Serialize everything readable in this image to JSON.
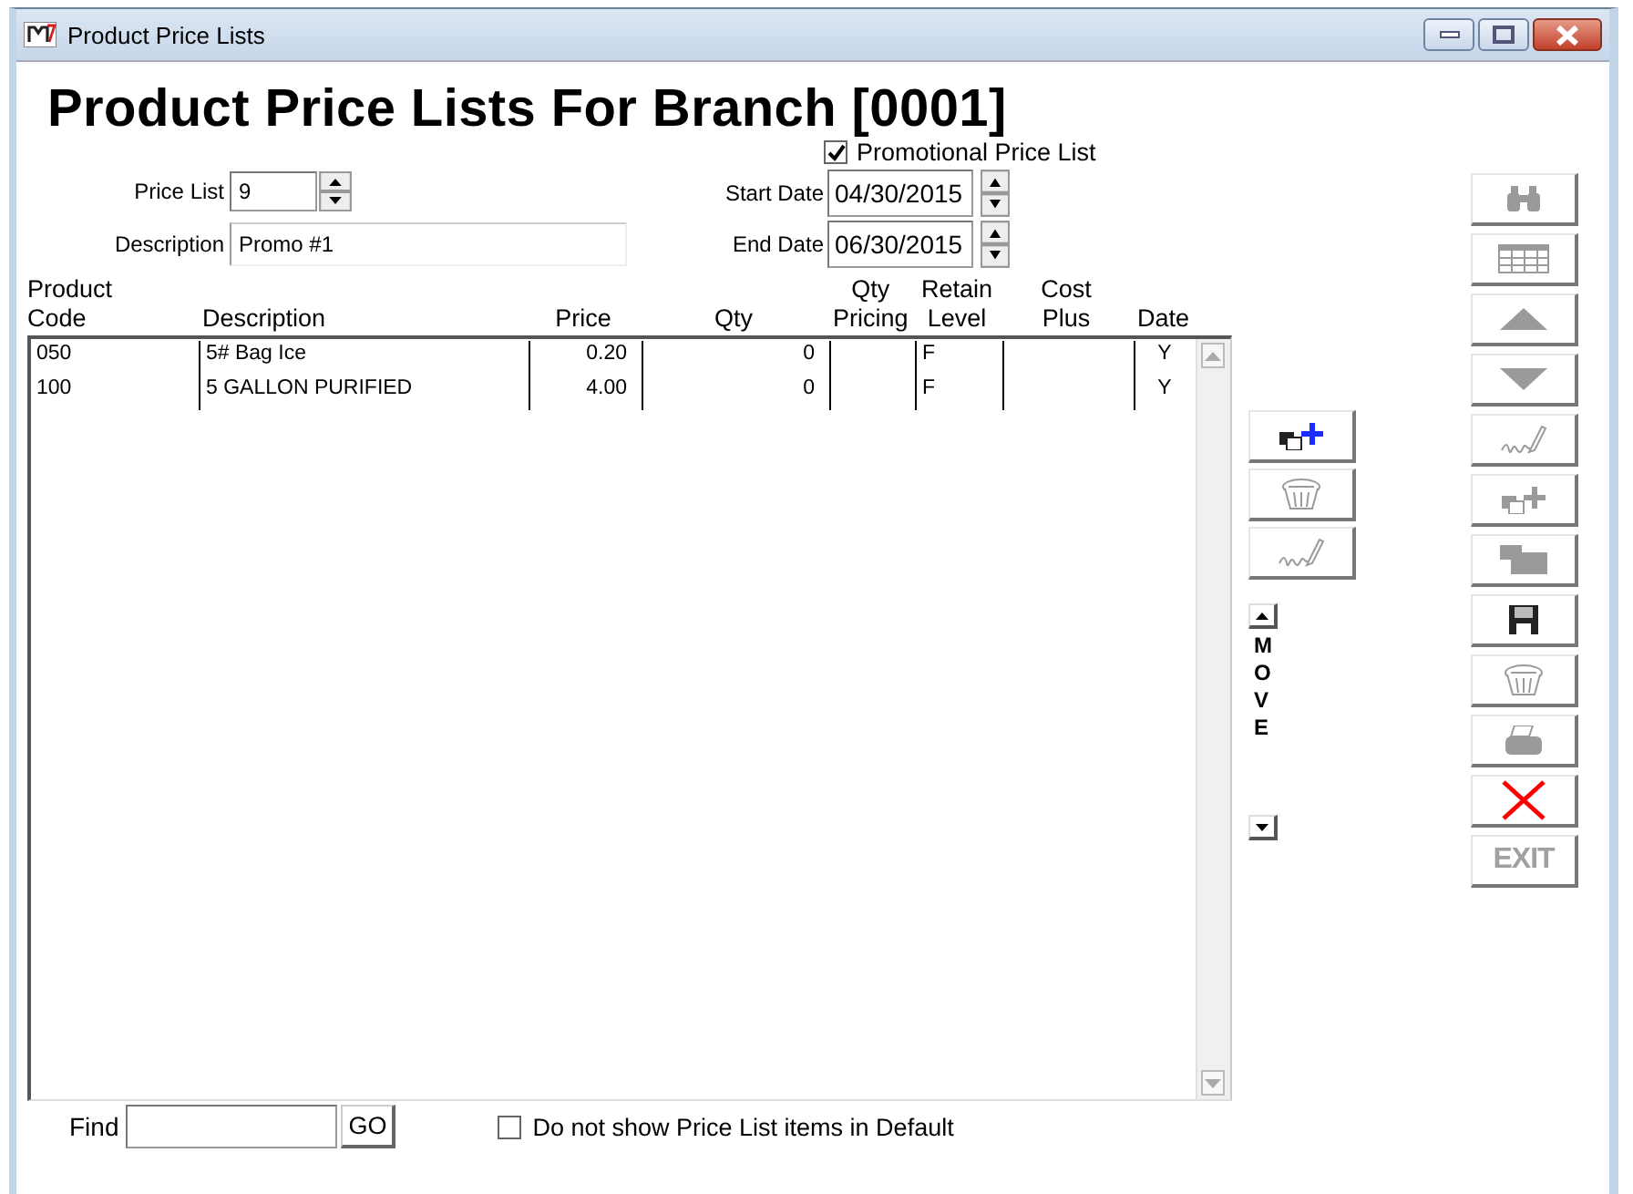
{
  "window": {
    "title": "Product Price Lists"
  },
  "heading": "Product Price Lists For Branch [0001]",
  "form": {
    "price_list": {
      "label": "Price List",
      "value": "9"
    },
    "description": {
      "label": "Description",
      "value": "Promo #1"
    },
    "promotional": {
      "label": "Promotional Price List",
      "checked": true
    },
    "start_date": {
      "label": "Start Date",
      "value": "04/30/2015"
    },
    "end_date": {
      "label": "End Date",
      "value": "06/30/2015"
    }
  },
  "table": {
    "columns": [
      "Product Code",
      "Description",
      "Price",
      "Qty",
      "Qty Pricing",
      "Retain Level",
      "Cost Plus",
      "Date"
    ],
    "rows": [
      [
        "050",
        "5# Bag Ice",
        "0.20",
        "0",
        "",
        "F",
        "",
        "Y"
      ],
      [
        "100",
        "5 GALLON PURIFIED",
        "4.00",
        "0",
        "",
        "F",
        "",
        "Y"
      ]
    ]
  },
  "row_tools": [
    {
      "kind": "copy-add",
      "disabled": false
    },
    {
      "kind": "basket",
      "disabled": true
    },
    {
      "kind": "sign",
      "disabled": true
    }
  ],
  "move": {
    "label": "MOVE"
  },
  "toolbar": [
    {
      "kind": "binoculars",
      "disabled": true
    },
    {
      "kind": "grid",
      "disabled": true
    },
    {
      "kind": "up",
      "disabled": true
    },
    {
      "kind": "down",
      "disabled": true
    },
    {
      "kind": "sign",
      "disabled": true
    },
    {
      "kind": "copy-add",
      "disabled": true
    },
    {
      "kind": "folder",
      "disabled": true
    },
    {
      "kind": "save",
      "disabled": false
    },
    {
      "kind": "basket",
      "disabled": true
    },
    {
      "kind": "printer",
      "disabled": true
    },
    {
      "kind": "delete",
      "disabled": false
    },
    {
      "kind": "text",
      "label": "EXIT",
      "disabled": true
    }
  ],
  "footer": {
    "find_label": "Find",
    "go": "GO",
    "hide_default": {
      "label": "Do not show Price List items in Default",
      "checked": false
    }
  }
}
